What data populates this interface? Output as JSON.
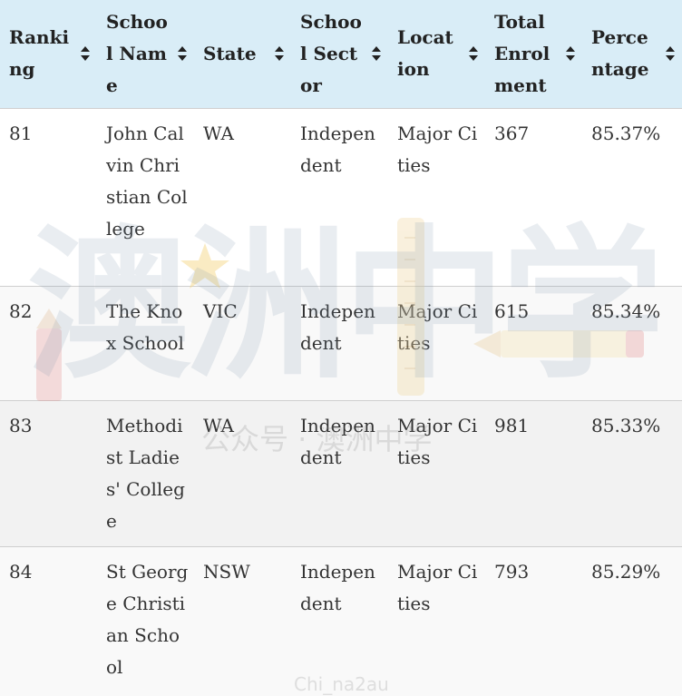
{
  "table": {
    "columns": [
      {
        "label": "Ranking"
      },
      {
        "label": "School Name"
      },
      {
        "label": "State"
      },
      {
        "label": "School Sector"
      },
      {
        "label": "Location"
      },
      {
        "label": "Total Enrolment"
      },
      {
        "label": "Percentage"
      }
    ],
    "rows": [
      {
        "ranking": "81",
        "school_name": "John Calvin Christian College",
        "state": "WA",
        "sector": "Independent",
        "location": "Major Cities",
        "enrolment": "367",
        "percentage": "85.37%"
      },
      {
        "ranking": "82",
        "school_name": "The Knox School",
        "state": "VIC",
        "sector": "Independent",
        "location": "Major Cities",
        "enrolment": "615",
        "percentage": "85.34%"
      },
      {
        "ranking": "83",
        "school_name": "Methodist Ladies' College",
        "state": "WA",
        "sector": "Independent",
        "location": "Major Cities",
        "enrolment": "981",
        "percentage": "85.33%"
      },
      {
        "ranking": "84",
        "school_name": "St George Christian School",
        "state": "NSW",
        "sector": "Independent",
        "location": "Major Cities",
        "enrolment": "793",
        "percentage": "85.29%"
      }
    ]
  },
  "watermark": {
    "logo_text": "澳洲中学",
    "subtitle": "公众号 · 澳洲中学",
    "handle": "Chi_na2au"
  },
  "colors": {
    "header_bg": "#d9edf7",
    "row_alt_bg": "#f9f9f9",
    "row_bg": "#ffffff",
    "border": "#cfcfcf",
    "text": "#333333"
  },
  "icons": {
    "sort": "sort-icon",
    "star": "star-icon",
    "ruler": "ruler-icon",
    "pencil": "pencil-icon"
  }
}
